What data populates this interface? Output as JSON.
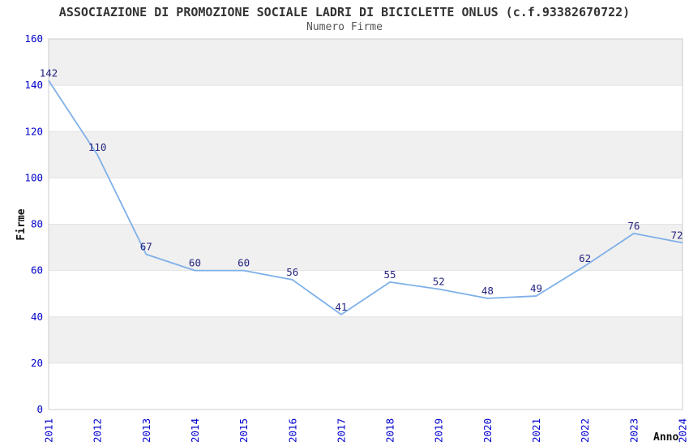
{
  "chart_data": {
    "type": "line",
    "title": "ASSOCIAZIONE DI PROMOZIONE SOCIALE LADRI DI BICICLETTE ONLUS (c.f.93382670722)",
    "subtitle": "Numero Firme",
    "xlabel": "Anno",
    "ylabel": "Firme",
    "categories": [
      "2011",
      "2012",
      "2013",
      "2014",
      "2015",
      "2016",
      "2017",
      "2018",
      "2019",
      "2020",
      "2021",
      "2022",
      "2023",
      "2024"
    ],
    "values": [
      142,
      110,
      67,
      60,
      60,
      56,
      41,
      55,
      52,
      48,
      49,
      62,
      76,
      72
    ],
    "ylim": [
      0,
      160
    ],
    "ytick_step": 20,
    "yticks": [
      0,
      20,
      40,
      60,
      80,
      100,
      120,
      140,
      160
    ],
    "grid": "alternating-horizontal-bands",
    "legend": "none",
    "x_tick_rotation": -90,
    "colors": {
      "line": "#7eb0e8",
      "data_label": "#252582",
      "tick_label": "#0000cd",
      "band": "#f0f0f0",
      "band_alt": "#ffffff",
      "gridline": "#e2e2e2",
      "border": "#cdcdcd",
      "title": "#333333",
      "subtitle": "#555555",
      "axis_title": "#111111",
      "background": "#ffffff"
    }
  }
}
